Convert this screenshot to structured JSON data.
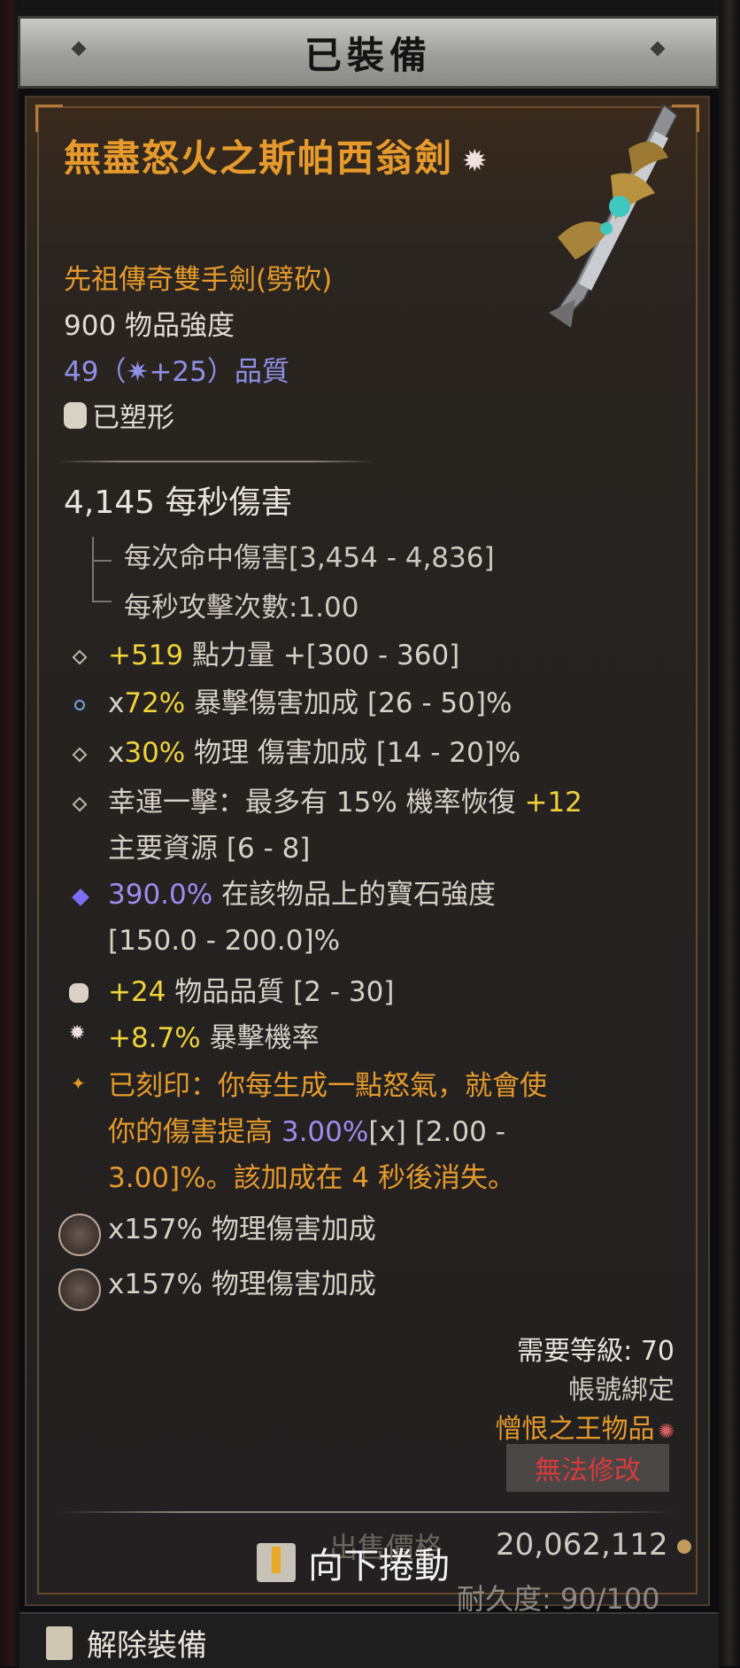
{
  "header": {
    "title": "已裝備"
  },
  "item": {
    "name": "無盡怒火之斯帕西翁劍",
    "type": "先祖傳奇雙手劍(劈砍)",
    "power": "900 物品強度",
    "quality": "49（✷+25）品質",
    "shaped": "已塑形"
  },
  "stats": {
    "dps": "4,145 每秒傷害",
    "damage_per_hit": "每次命中傷害[3,454 - 4,836]",
    "attacks_per_second": "每秒攻擊次數:1.00"
  },
  "affixes": [
    {
      "value": "+519",
      "text": " 點力量 +[300 - 360]"
    },
    {
      "prefix": "x",
      "value": "72%",
      "text": " 暴擊傷害加成 [26 - 50]%"
    },
    {
      "prefix": "x",
      "value": "30%",
      "text": " 物理 傷害加成 [14 - 20]%"
    },
    {
      "line1_a": "幸運一擊：最多有 15% 機率恢復 ",
      "line1_b": "+12",
      "line2": "主要資源 [6 - 8]"
    },
    {
      "value": "390.0%",
      "text": " 在該物品上的寶石強度",
      "line2": "[150.0 - 200.0]%"
    },
    {
      "value": "+24",
      "text": " 物品品質 [2 - 30]"
    },
    {
      "value": "+8.7%",
      "text": " 暴擊機率"
    }
  ],
  "imprint": {
    "line1": "已刻印：你每生成一點怒氣，就會使",
    "line2_a": "你的傷害提高 ",
    "line2_b": "3.00%",
    "line2_c": "[x] [2.00 -",
    "line3": "3.00]%。該加成在 4 秒後消失。"
  },
  "sockets": [
    {
      "text": "x157% 物理傷害加成"
    },
    {
      "text": "x157% 物理傷害加成"
    }
  ],
  "requirements": {
    "level": "需要等級: 70",
    "bound": "帳號綁定",
    "hatred": "憎恨之王物品"
  },
  "cannot_modify": "無法修改",
  "footer": {
    "gold_label": "出售價格",
    "price": "20,062,112",
    "durability": "耐久度: 90/100",
    "scroll_hint": "向下捲動",
    "unequip": "解除裝備"
  },
  "colors": {
    "legendary_orange": "#e69a2c",
    "affix_yellow": "#f0d23a",
    "gem_purple": "#9f8cf0",
    "quality_blue": "#8f90e6",
    "warning_red": "#d83a3a"
  }
}
